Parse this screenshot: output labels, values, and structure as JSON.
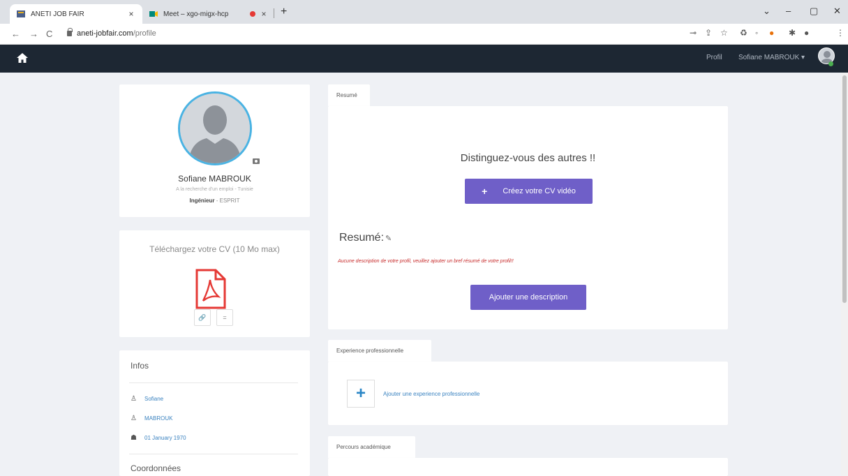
{
  "browser": {
    "tabs": [
      {
        "title": "ANETI JOB FAIR",
        "close": "×"
      },
      {
        "title": "Meet – xgo-migx-hcp",
        "close": "×"
      }
    ],
    "new_tab": "+",
    "window_controls": [
      "⌄",
      "–",
      "▢",
      "✕"
    ],
    "nav": {
      "back": "←",
      "forward": "→",
      "reload": "C"
    },
    "url": {
      "host": "aneti-jobfair.com",
      "path": "/profile"
    }
  },
  "navbar": {
    "profil": "Profil",
    "user_menu": "Sofiane MABROUK ▾"
  },
  "profile": {
    "name": "Sofiane MABROUK",
    "status": "A la recherche d'un emploi - Tunisie",
    "title_strong": "Ingénieur",
    "title_rest": " - ESPRIT"
  },
  "cv": {
    "heading": "Téléchargez votre CV (10 Mo max)",
    "link_btn": "🔗",
    "menu_btn": "="
  },
  "infos": {
    "title": "Infos",
    "first_name": "Sofiane",
    "last_name": "MABROUK",
    "birthdate": "01 January 1970",
    "coordonnees": "Coordonnées"
  },
  "resume_tab": {
    "label": "Resumé",
    "heading": "Distinguez-vous des autres !!",
    "cv_video_btn": "Créez votre CV vidéo",
    "cv_video_plus": "+",
    "resume_label": "Resumé:",
    "warning": "Aucune description de votre profil, veuillez ajouter un bref résumé de votre profil!!",
    "add_desc_btn": "Ajouter une description"
  },
  "experience_tab": {
    "label": "Experience professionnelle",
    "add_text": "Ajouter une experience professionnelle"
  },
  "academic_tab": {
    "label": "Percours académique"
  },
  "colors": {
    "navbar": "#1d2733",
    "accent": "#6f5fc8",
    "link": "#3b83c0",
    "warning": "#c62828",
    "avatar_ring": "#4ab3e3"
  }
}
